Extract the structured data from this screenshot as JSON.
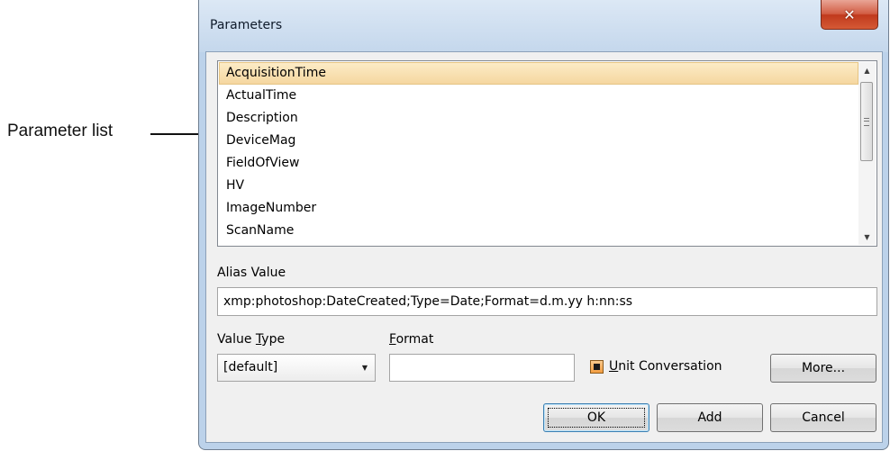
{
  "callout": {
    "label": "Parameter list"
  },
  "window": {
    "title": "Parameters",
    "close_icon": "close-icon"
  },
  "parameter_list": {
    "items": [
      "AcquisitionTime",
      "ActualTime",
      "Description",
      "DeviceMag",
      "FieldOfView",
      "HV",
      "ImageNumber",
      "ScanName"
    ],
    "selected_index": 0
  },
  "alias": {
    "label": "Alias Value",
    "value": "xmp:photoshop:DateCreated;Type=Date;Format=d.m.yy h:nn:ss"
  },
  "value_type": {
    "label_pre": "Value ",
    "label_mnemonic": "T",
    "label_post": "ype",
    "selected": "[default]"
  },
  "format": {
    "label_mnemonic": "F",
    "label_post": "ormat",
    "value": ""
  },
  "unit_conversation": {
    "label_mnemonic": "U",
    "label_post": "nit Conversation",
    "state": "indeterminate"
  },
  "buttons": {
    "more": "More...",
    "ok": "OK",
    "add": "Add",
    "cancel": "Cancel"
  },
  "colors": {
    "selection": "#f5d7a0",
    "close_button": "#c0391d",
    "frame": "#bcd2ea"
  }
}
